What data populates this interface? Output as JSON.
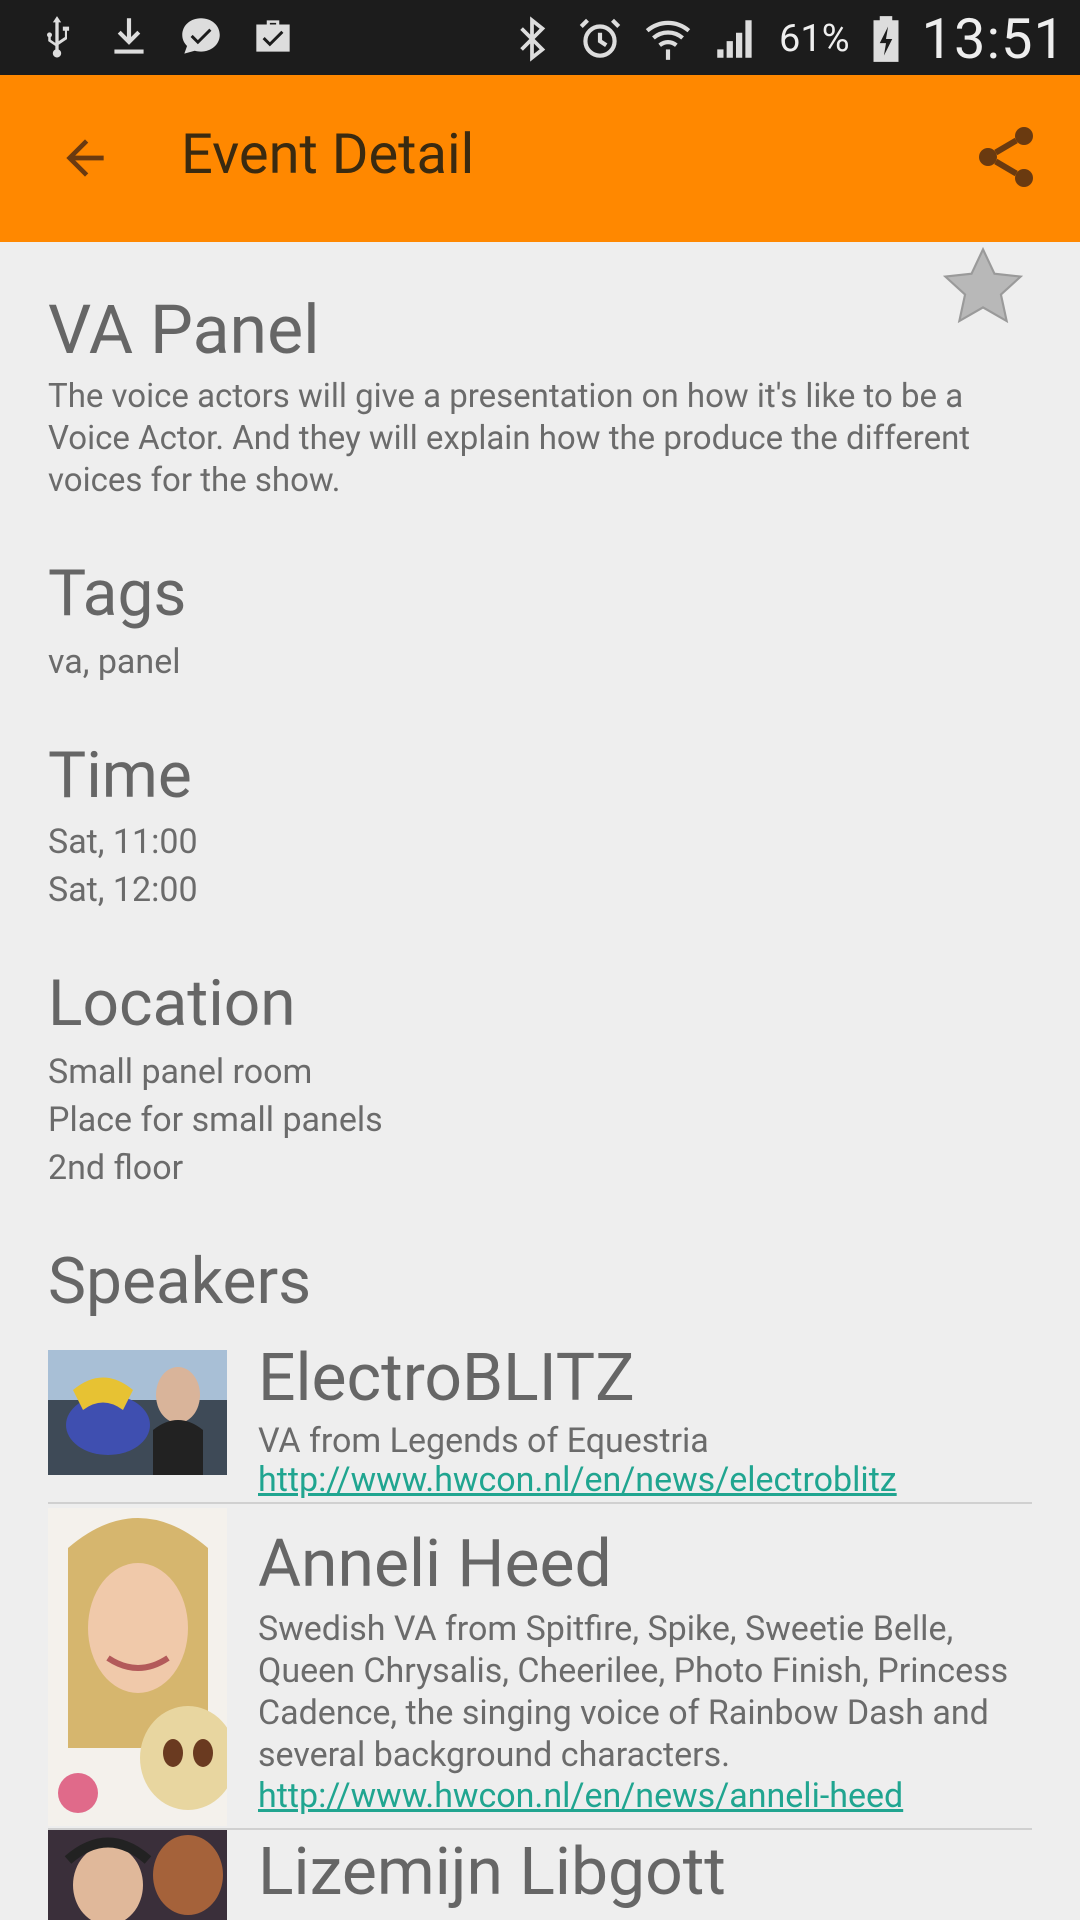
{
  "status_bar": {
    "battery": "61%",
    "time": "13:51",
    "left_icons": [
      "usb-icon",
      "download-icon",
      "chat-icon",
      "briefcase-check-icon"
    ],
    "right_icons": [
      "bluetooth-icon",
      "alarm-icon",
      "wifi-icon",
      "signal-icon",
      "battery-charging-icon"
    ]
  },
  "app_bar": {
    "title": "Event Detail",
    "color": "#ff8800"
  },
  "event": {
    "title": "VA Panel",
    "description": "The voice actors will give a presentation on how it's like to be a Voice Actor. And they will explain how the produce the different voices for the show."
  },
  "tags": {
    "heading": "Tags",
    "value": "va, panel"
  },
  "time": {
    "heading": "Time",
    "start": "Sat, 11:00",
    "end": "Sat, 12:00"
  },
  "location": {
    "heading": "Location",
    "name": "Small panel room",
    "description": "Place for small panels",
    "floor": "2nd floor"
  },
  "speakers": {
    "heading": "Speakers",
    "items": [
      {
        "name": "ElectroBLITZ",
        "bio": "VA from Legends of Equestria",
        "link": "http://www.hwcon.nl/en/news/electroblitz"
      },
      {
        "name": "Anneli Heed",
        "bio": "Swedish VA from Spitfire, Spike, Sweetie Belle, Queen Chrysalis, Cheerilee, Photo Finish, Princess Cadence, the singing voice of Rainbow Dash and several background characters.",
        "link": "http://www.hwcon.nl/en/news/anneli-heed"
      },
      {
        "name": "Lizemijn Libgott"
      }
    ]
  }
}
